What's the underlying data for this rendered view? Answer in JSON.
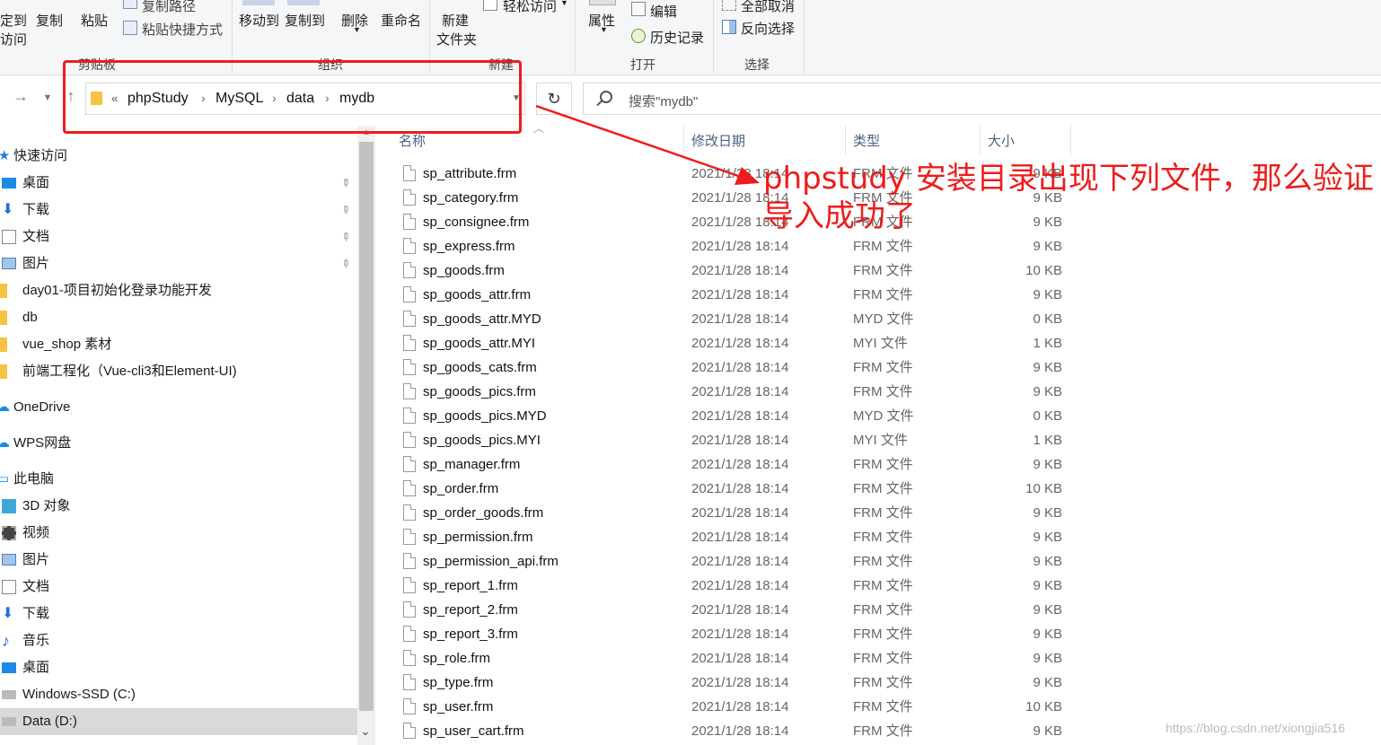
{
  "ribbon": {
    "clip_pin_label_1": "定到",
    "clip_pin_label_2": "访问",
    "copy_label": "复制",
    "paste_label": "粘贴",
    "copy_path_label": "复制路径",
    "paste_shortcut_label": "粘贴快捷方式",
    "clipboard_group": "剪贴板",
    "move_to_label": "移动到",
    "copy_to_label": "复制到",
    "delete_label": "删除",
    "rename_label": "重命名",
    "organize_group": "组织",
    "new_folder_label_1": "新建",
    "new_folder_label_2": "文件夹",
    "easy_access_label": "轻松访问",
    "new_group": "新建",
    "properties_label": "属性",
    "edit_label": "编辑",
    "history_label": "历史记录",
    "open_group": "打开",
    "select_none_label": "全部取消",
    "invert_selection_label": "反向选择",
    "select_group": "选择"
  },
  "address": {
    "overflow": "«",
    "crumbs": [
      "phpStudy",
      "MySQL",
      "data",
      "mydb"
    ],
    "search_placeholder": "搜索\"mydb\""
  },
  "columns": {
    "name": "名称",
    "date": "修改日期",
    "type": "类型",
    "size": "大小"
  },
  "nav": {
    "quick_access": "快速访问",
    "items": [
      {
        "label": "桌面",
        "icon": "desktop-icon",
        "pinned": true
      },
      {
        "label": "下载",
        "icon": "download-icon",
        "pinned": true
      },
      {
        "label": "文档",
        "icon": "document-icon",
        "pinned": true
      },
      {
        "label": "图片",
        "icon": "picture-icon",
        "pinned": true
      },
      {
        "label": "day01-项目初始化登录功能开发",
        "icon": "folder-icon"
      },
      {
        "label": "db",
        "icon": "folder-icon"
      },
      {
        "label": "vue_shop 素材",
        "icon": "folder-icon"
      },
      {
        "label": "前端工程化（Vue-cli3和Element-UI)",
        "icon": "folder-icon"
      }
    ],
    "onedrive": "OneDrive",
    "wps": "WPS网盘",
    "this_pc": "此电脑",
    "pc_items": [
      {
        "label": "3D 对象",
        "icon": "3d-objects-icon"
      },
      {
        "label": "视频",
        "icon": "video-icon"
      },
      {
        "label": "图片",
        "icon": "picture-icon"
      },
      {
        "label": "文档",
        "icon": "document-icon"
      },
      {
        "label": "下载",
        "icon": "download-icon"
      },
      {
        "label": "音乐",
        "icon": "music-icon"
      },
      {
        "label": "桌面",
        "icon": "desktop-icon"
      },
      {
        "label": "Windows-SSD (C:)",
        "icon": "drive-icon"
      },
      {
        "label": "Data (D:)",
        "icon": "drive-icon"
      }
    ],
    "pin_glyph": "📌"
  },
  "files": [
    {
      "name": "sp_attribute.frm",
      "date": "2021/1/28 18:14",
      "type": "FRM 文件",
      "size": "9 KB"
    },
    {
      "name": "sp_category.frm",
      "date": "2021/1/28 18:14",
      "type": "FRM 文件",
      "size": "9 KB"
    },
    {
      "name": "sp_consignee.frm",
      "date": "2021/1/28 18:14",
      "type": "FRM 文件",
      "size": "9 KB"
    },
    {
      "name": "sp_express.frm",
      "date": "2021/1/28 18:14",
      "type": "FRM 文件",
      "size": "9 KB"
    },
    {
      "name": "sp_goods.frm",
      "date": "2021/1/28 18:14",
      "type": "FRM 文件",
      "size": "10 KB"
    },
    {
      "name": "sp_goods_attr.frm",
      "date": "2021/1/28 18:14",
      "type": "FRM 文件",
      "size": "9 KB"
    },
    {
      "name": "sp_goods_attr.MYD",
      "date": "2021/1/28 18:14",
      "type": "MYD 文件",
      "size": "0 KB"
    },
    {
      "name": "sp_goods_attr.MYI",
      "date": "2021/1/28 18:14",
      "type": "MYI 文件",
      "size": "1 KB"
    },
    {
      "name": "sp_goods_cats.frm",
      "date": "2021/1/28 18:14",
      "type": "FRM 文件",
      "size": "9 KB"
    },
    {
      "name": "sp_goods_pics.frm",
      "date": "2021/1/28 18:14",
      "type": "FRM 文件",
      "size": "9 KB"
    },
    {
      "name": "sp_goods_pics.MYD",
      "date": "2021/1/28 18:14",
      "type": "MYD 文件",
      "size": "0 KB"
    },
    {
      "name": "sp_goods_pics.MYI",
      "date": "2021/1/28 18:14",
      "type": "MYI 文件",
      "size": "1 KB"
    },
    {
      "name": "sp_manager.frm",
      "date": "2021/1/28 18:14",
      "type": "FRM 文件",
      "size": "9 KB"
    },
    {
      "name": "sp_order.frm",
      "date": "2021/1/28 18:14",
      "type": "FRM 文件",
      "size": "10 KB"
    },
    {
      "name": "sp_order_goods.frm",
      "date": "2021/1/28 18:14",
      "type": "FRM 文件",
      "size": "9 KB"
    },
    {
      "name": "sp_permission.frm",
      "date": "2021/1/28 18:14",
      "type": "FRM 文件",
      "size": "9 KB"
    },
    {
      "name": "sp_permission_api.frm",
      "date": "2021/1/28 18:14",
      "type": "FRM 文件",
      "size": "9 KB"
    },
    {
      "name": "sp_report_1.frm",
      "date": "2021/1/28 18:14",
      "type": "FRM 文件",
      "size": "9 KB"
    },
    {
      "name": "sp_report_2.frm",
      "date": "2021/1/28 18:14",
      "type": "FRM 文件",
      "size": "9 KB"
    },
    {
      "name": "sp_report_3.frm",
      "date": "2021/1/28 18:14",
      "type": "FRM 文件",
      "size": "9 KB"
    },
    {
      "name": "sp_role.frm",
      "date": "2021/1/28 18:14",
      "type": "FRM 文件",
      "size": "9 KB"
    },
    {
      "name": "sp_type.frm",
      "date": "2021/1/28 18:14",
      "type": "FRM 文件",
      "size": "9 KB"
    },
    {
      "name": "sp_user.frm",
      "date": "2021/1/28 18:14",
      "type": "FRM 文件",
      "size": "10 KB"
    },
    {
      "name": "sp_user_cart.frm",
      "date": "2021/1/28 18:14",
      "type": "FRM 文件",
      "size": "9 KB"
    }
  ],
  "annotation": {
    "line1": "phpstudy 安装目录出现下列文件，那么验证",
    "line2": "导入成功了"
  },
  "watermark": "https://blog.csdn.net/xiongjia516",
  "colors": {
    "annotation_red": "#ee1c1c",
    "selected_bg": "#d9d9d9",
    "header_text": "#4d6082"
  }
}
